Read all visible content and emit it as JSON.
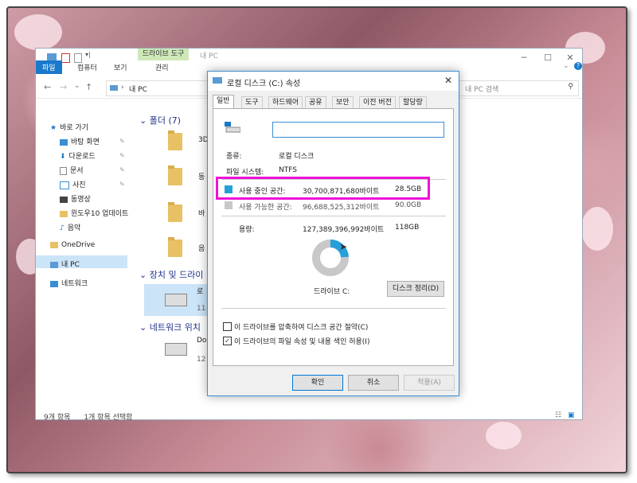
{
  "explorer": {
    "ribbon_context_tab": "드라이브 도구",
    "window_title": "내 PC",
    "tabs": {
      "file": "파일",
      "computer": "컴퓨터",
      "view": "보기",
      "manage": "관리"
    },
    "address": "내 PC",
    "search_placeholder": "내 PC 검색",
    "nav": {
      "quick_access": "바로 가기",
      "desktop": "바탕 화면",
      "downloads": "다운로드",
      "documents": "문서",
      "pictures": "사진",
      "videos": "동영상",
      "win10_update": "윈도우10 업데이트",
      "music": "음악",
      "onedrive": "OneDrive",
      "this_pc": "내 PC",
      "network": "네트워크"
    },
    "groups": {
      "folders": "폴더 (7)",
      "devices": "장치 및 드라이",
      "network_loc": "네트워크 위치"
    },
    "items": {
      "f1": "3D",
      "f2": "동",
      "f3": "바",
      "f4": "음",
      "drive": "로",
      "drive_sub": "11",
      "net": "Do",
      "net_sub": "12"
    },
    "status": {
      "count": "9개 항목",
      "selected": "1개 항목 선택함"
    }
  },
  "dialog": {
    "title": "로컬 디스크 (C:) 속성",
    "tabs": [
      "일반",
      "도구",
      "하드웨어",
      "공유",
      "보안",
      "이전 버전",
      "할당량"
    ],
    "name_value": "",
    "type_label": "종류:",
    "type_value": "로컬 디스크",
    "fs_label": "파일 시스템:",
    "fs_value": "NTFS",
    "used": {
      "label": "사용 중인 공간:",
      "bytes": "30,700,871,680바이트",
      "size": "28.5GB",
      "fraction": 0.241
    },
    "free": {
      "label": "사용 가능한 공간:",
      "bytes": "96,688,525,312바이트",
      "size": "90.0GB"
    },
    "capacity": {
      "label": "용량:",
      "bytes": "127,389,396,992바이트",
      "size": "118GB"
    },
    "drive_label": "드라이브 C:",
    "cleanup_button": "디스크 정리(D)",
    "compress_option": "이 드라이브를 압축하여 디스크 공간 절약(C)",
    "index_option": "이 드라이브의 파일 속성 및 내용 색인 허용(I)",
    "compress_checked": false,
    "index_checked": true,
    "ok": "확인",
    "cancel": "취소",
    "apply": "적용(A)"
  },
  "colors": {
    "used": "#26a0da",
    "free": "#c8c8c8",
    "accent": "#1979ca",
    "highlight": "#ee12d8"
  }
}
